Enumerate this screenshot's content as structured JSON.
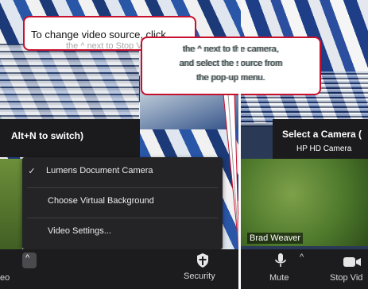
{
  "callouts": {
    "left_text": "To change video source, click",
    "left_partial": "the ^ next to Stop Video",
    "right_lines": [
      "the ^ next to the camera,",
      "and select the source from",
      "the pop-up menu."
    ]
  },
  "left_panel": {
    "switch_hint": "Alt+N to switch)",
    "menu": {
      "items": [
        {
          "label": "Lumens Document Camera",
          "checked": true
        },
        {
          "label": "Choose Virtual Background",
          "checked": false
        },
        {
          "label": "Video Settings...",
          "checked": false
        }
      ],
      "check_glyph": "✓"
    },
    "toolbar": {
      "video_label": "eo",
      "chevron": "^",
      "security_label": "Security"
    }
  },
  "right_panel": {
    "camera_header": "Select a Camera (",
    "camera_option": "HP HD Camera",
    "participant_name": "Brad Weaver",
    "toolbar": {
      "mute_label": "Mute",
      "mute_chevron": "^",
      "stop_video_label": "Stop Vid"
    }
  },
  "colors": {
    "callout_border": "#c8102e",
    "menu_bg": "#242426",
    "toolbar_bg": "#1c1c1e"
  },
  "icons": [
    "shield-icon",
    "microphone-icon",
    "camera-icon",
    "chevron-up-icon",
    "checkmark-icon"
  ]
}
